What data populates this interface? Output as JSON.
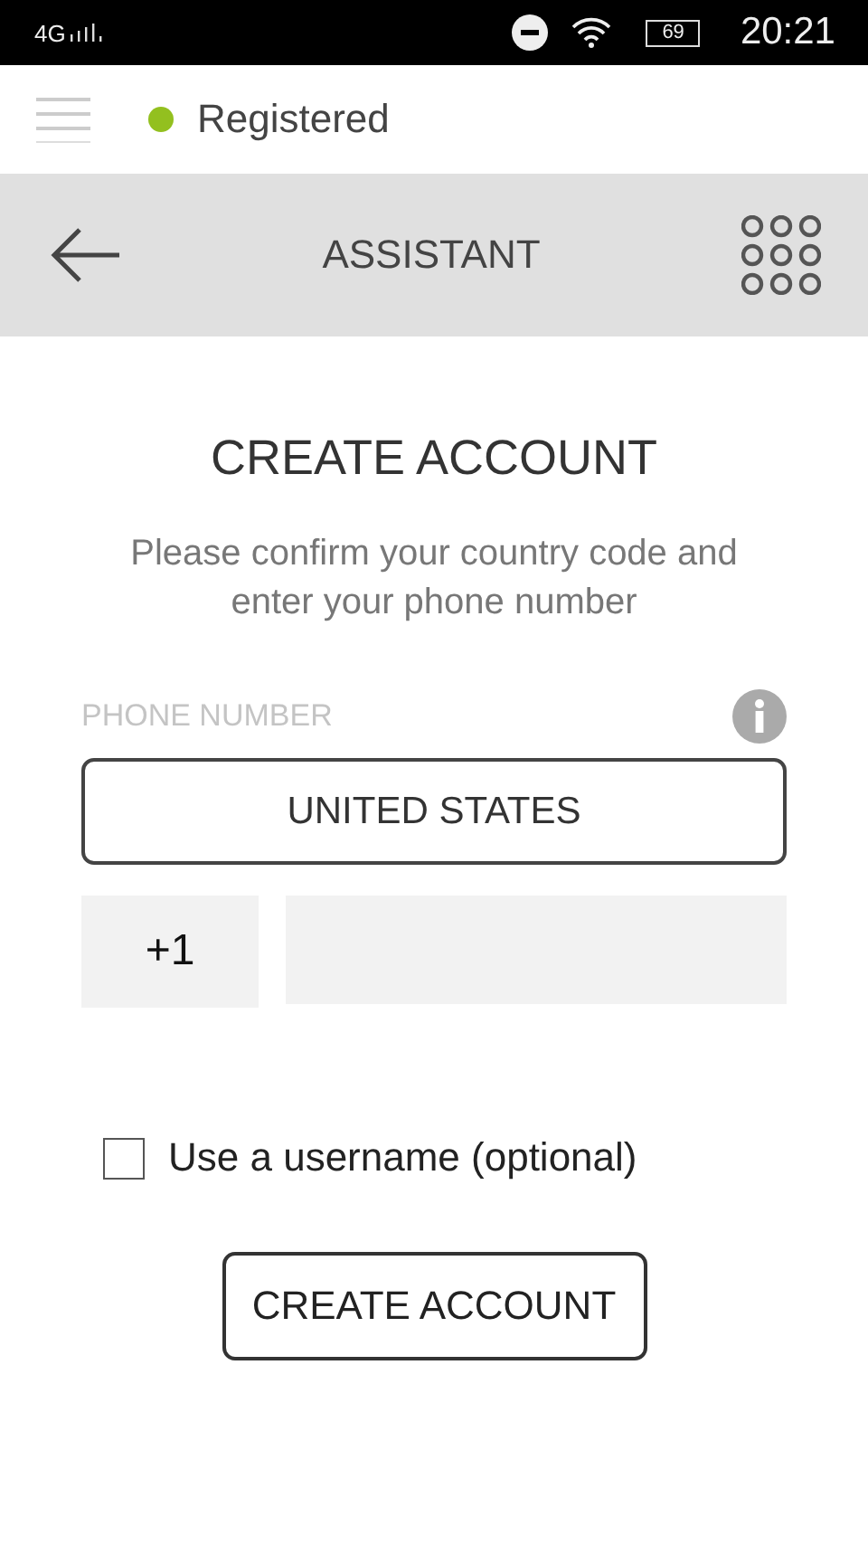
{
  "status_bar": {
    "network": "4G",
    "battery": "69",
    "time": "20:21"
  },
  "top_bar": {
    "status": {
      "label": "Registered",
      "connected": true
    }
  },
  "header": {
    "title": "ASSISTANT"
  },
  "form": {
    "title": "CREATE ACCOUNT",
    "subtitle": "Please confirm your country code and enter your phone number",
    "phone_label": "PHONE NUMBER",
    "country": "UNITED STATES",
    "country_code": "+1",
    "username_option": {
      "label": "Use a username (optional)",
      "checked": false
    },
    "submit": "CREATE ACCOUNT"
  }
}
